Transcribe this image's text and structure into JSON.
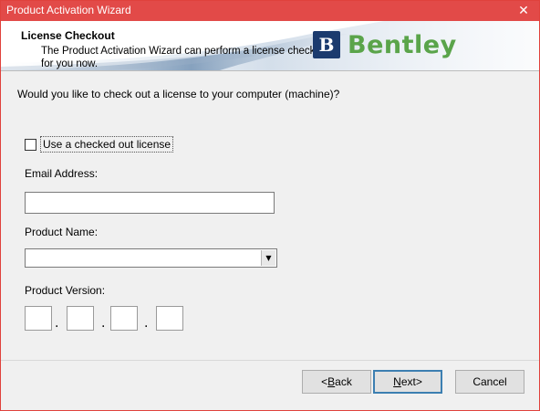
{
  "window": {
    "title": "Product Activation Wizard",
    "close_glyph": "✕"
  },
  "banner": {
    "heading": "License Checkout",
    "description": "The Product Activation Wizard can perform a license checkout for you now.",
    "logo_mark": "B",
    "logo_text": "Bentley",
    "logo_color": "#5aa44a"
  },
  "form": {
    "question": "Would you like to check out a license to your computer (machine)?",
    "use_checked_out_label": "Use a checked out license",
    "use_checked_out_checked": false,
    "email_label": "Email Address:",
    "email_value": "",
    "product_name_label": "Product Name:",
    "product_name_value": "",
    "product_version_label": "Product Version:",
    "version_parts": [
      "",
      "",
      "",
      ""
    ],
    "version_separator": "."
  },
  "buttons": {
    "back_prefix": "<",
    "back_hotkey": "B",
    "back_rest": "ack",
    "next_hotkey": "N",
    "next_rest": "ext>",
    "cancel": "Cancel"
  },
  "colors": {
    "titlebar": "#e24a48",
    "logo_mark_bg": "#1b3b6e"
  }
}
